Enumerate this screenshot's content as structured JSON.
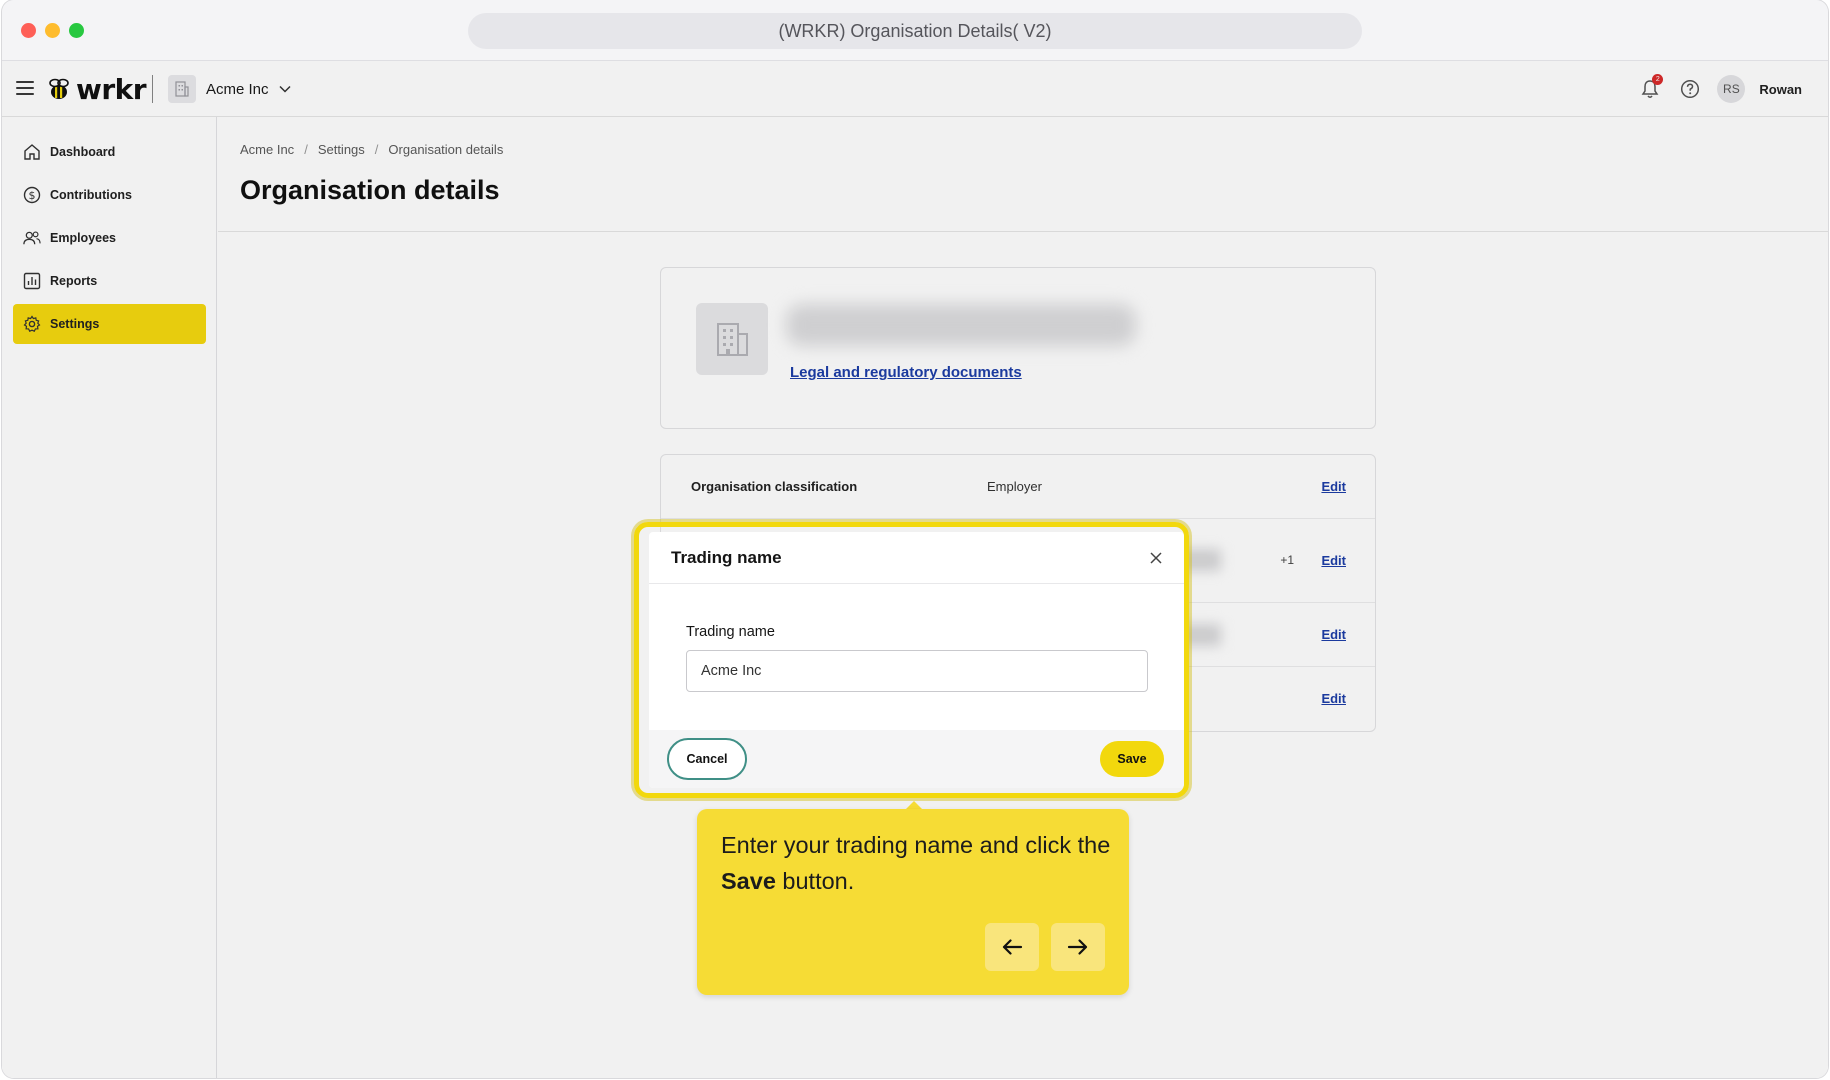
{
  "browser": {
    "title": "(WRKR) Organisation Details( V2)"
  },
  "topbar": {
    "brand": "wrkr",
    "org_name": "Acme Inc",
    "notification_count": "2",
    "user_initials": "RS",
    "user_name": "Rowan"
  },
  "sidebar": {
    "items": [
      {
        "label": "Dashboard",
        "icon": "home-icon"
      },
      {
        "label": "Contributions",
        "icon": "dollar-icon"
      },
      {
        "label": "Employees",
        "icon": "people-icon"
      },
      {
        "label": "Reports",
        "icon": "chart-icon"
      },
      {
        "label": "Settings",
        "icon": "gear-icon",
        "active": true
      }
    ]
  },
  "breadcrumb": [
    "Acme Inc",
    "Settings",
    "Organisation details"
  ],
  "page": {
    "title": "Organisation details",
    "legal_link": "Legal and regulatory documents",
    "rows": [
      {
        "label": "Organisation classification",
        "value": "Employer",
        "edit": "Edit"
      },
      {
        "label": "",
        "value": "",
        "extra": "+1",
        "edit": "Edit"
      },
      {
        "label": "",
        "value": "",
        "edit": "Edit"
      },
      {
        "label": "",
        "value": "",
        "edit": "Edit"
      }
    ]
  },
  "modal": {
    "title": "Trading name",
    "field_label": "Trading name",
    "field_value": "Acme Inc",
    "cancel_label": "Cancel",
    "save_label": "Save"
  },
  "tooltip": {
    "text_before": "Enter your trading name and click the ",
    "text_bold": "Save",
    "text_after": " button."
  },
  "colors": {
    "accent_yellow": "#f2d80d",
    "link_blue": "#1d3ea8",
    "cancel_border": "#3f8f86"
  }
}
